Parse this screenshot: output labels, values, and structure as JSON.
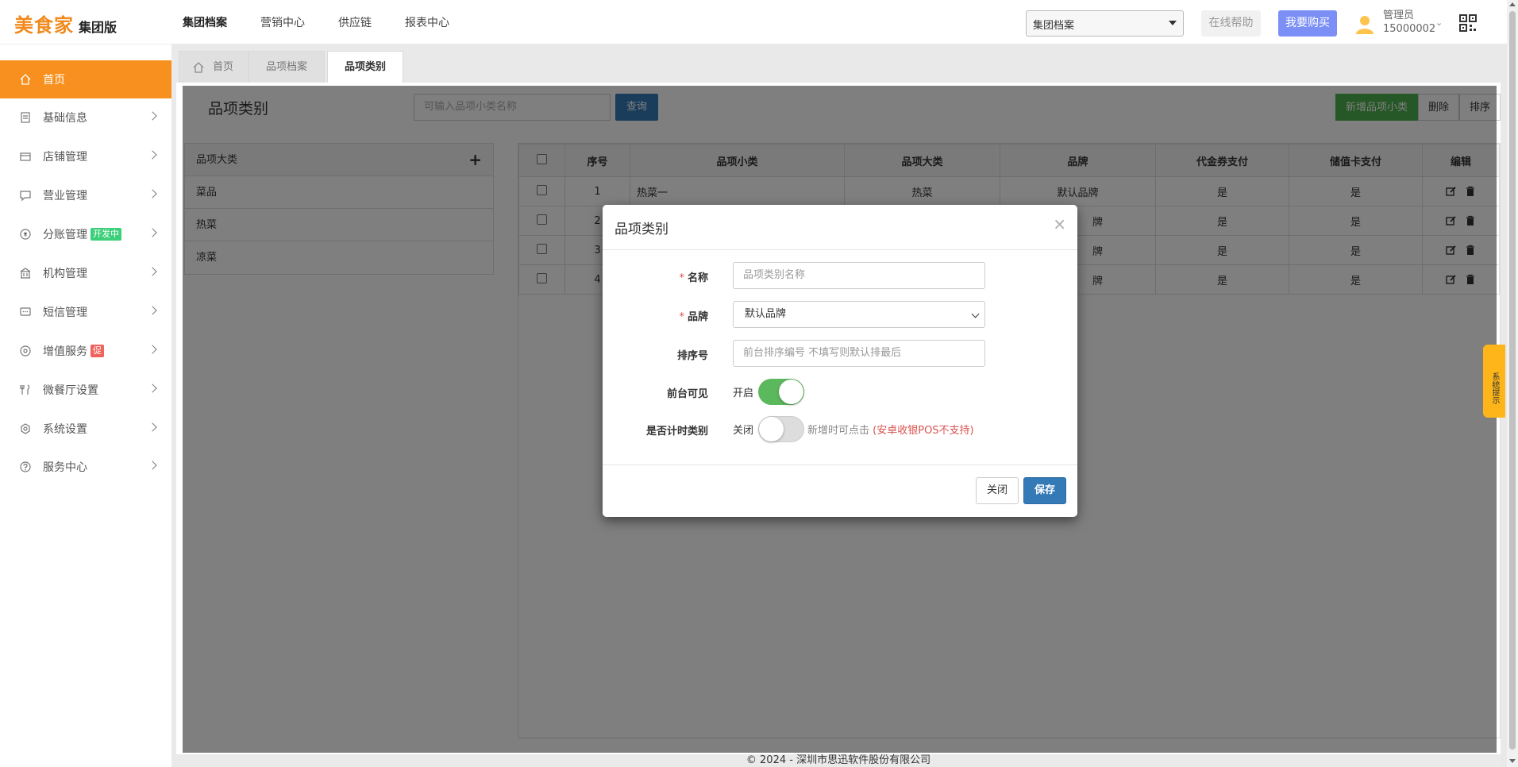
{
  "header": {
    "brand": "美食家",
    "edition": "集团版",
    "nav": [
      "集团档案",
      "营销中心",
      "供应链",
      "报表中心"
    ],
    "active_nav": "集团档案",
    "select_value": "集团档案",
    "help_label": "在线帮助",
    "buy_label": "我要购买",
    "user_role": "管理员",
    "user_id": "15000002"
  },
  "sidebar": {
    "items": [
      {
        "label": "首页",
        "active": true
      },
      {
        "label": "基础信息"
      },
      {
        "label": "店铺管理"
      },
      {
        "label": "营业管理"
      },
      {
        "label": "分账管理",
        "badge": "开发中",
        "badge_color": "#3ccf7a"
      },
      {
        "label": "机构管理"
      },
      {
        "label": "短信管理"
      },
      {
        "label": "增值服务",
        "badge": "促",
        "badge_color": "#f0625d"
      },
      {
        "label": "微餐厅设置"
      },
      {
        "label": "系统设置"
      },
      {
        "label": "服务中心"
      }
    ]
  },
  "tabs": [
    "首页",
    "品项档案",
    "品项类别"
  ],
  "content": {
    "title": "品项类别",
    "search_placeholder": "可输入品项小类名称",
    "query_label": "查询",
    "add_label": "新增品项小类",
    "delete_label": "删除",
    "sort_label": "排序",
    "category_header": "品项大类",
    "categories": [
      "菜品",
      "热菜",
      "凉菜"
    ],
    "columns": [
      "序号",
      "品项小类",
      "品项大类",
      "品牌",
      "代金券支付",
      "储值卡支付",
      "编辑"
    ],
    "rows": [
      {
        "no": "1",
        "sub": "热菜一",
        "major": "热菜",
        "brand": "默认品牌",
        "voucher": "是",
        "card": "是"
      },
      {
        "no": "2",
        "sub": "",
        "major": "",
        "brand": "牌",
        "voucher": "是",
        "card": "是"
      },
      {
        "no": "3",
        "sub": "",
        "major": "",
        "brand": "牌",
        "voucher": "是",
        "card": "是"
      },
      {
        "no": "4",
        "sub": "",
        "major": "",
        "brand": "牌",
        "voucher": "是",
        "card": "是"
      }
    ]
  },
  "footer": "© 2024 - 深圳市思迅软件股份有限公司",
  "side_tip": "系统提示",
  "modal": {
    "title": "品项类别",
    "close_x": "×",
    "name_label": "名称",
    "name_placeholder": "品项类别名称",
    "brand_label": "品牌",
    "brand_value": "默认品牌",
    "sort_label": "排序号",
    "sort_placeholder": "前台排序编号 不填写则默认排最后",
    "visible_label": "前台可见",
    "visible_state": "开启",
    "timed_label": "是否计时类别",
    "timed_state": "关闭",
    "timed_hint": "新增时可点击",
    "timed_warning": "(安卓收银POS不支持)",
    "close_label": "关闭",
    "save_label": "保存"
  },
  "colors": {
    "accent": "#f7901e",
    "primary": "#337ab7",
    "success": "#5cb85c"
  }
}
